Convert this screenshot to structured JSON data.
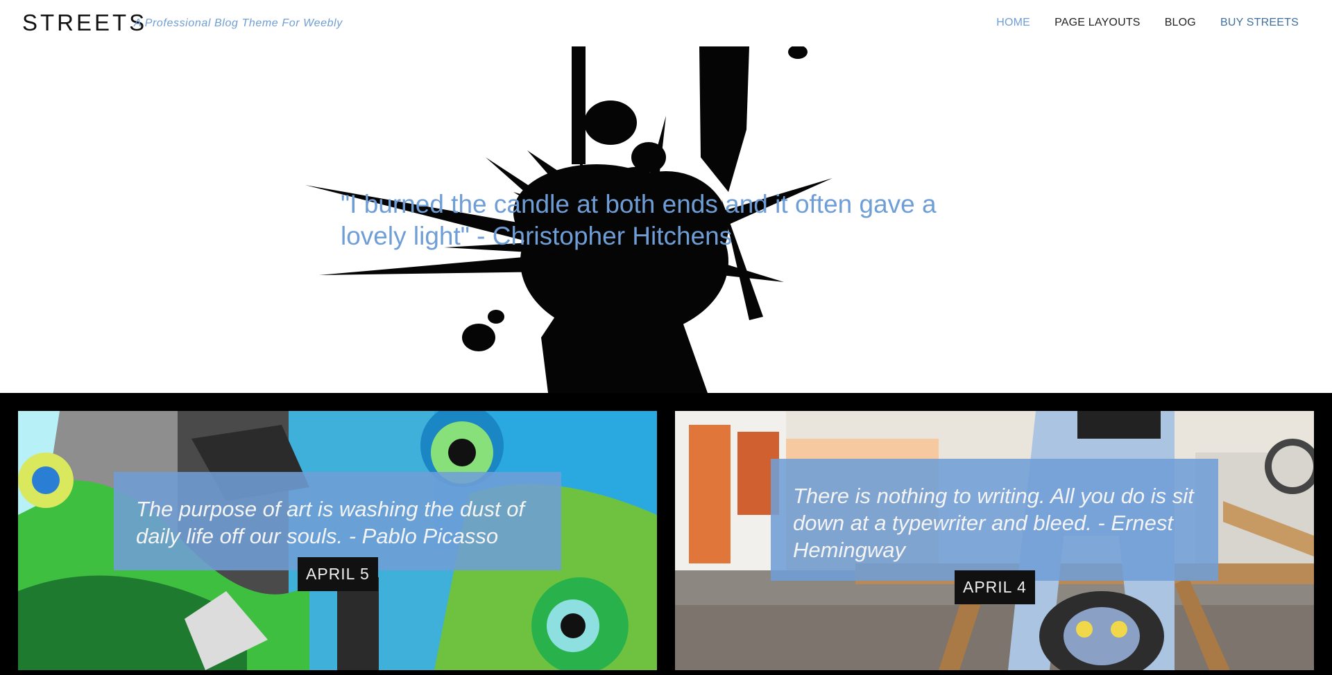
{
  "header": {
    "logo": "STREETS",
    "tagline": "A Professional Blog Theme For Weebly",
    "nav": [
      {
        "label": "HOME"
      },
      {
        "label": "PAGE LAYOUTS"
      },
      {
        "label": "BLOG"
      },
      {
        "label": "BUY STREETS"
      }
    ]
  },
  "hero": {
    "quote": "\"I burned the candle at both ends and it often gave a lovely light\" - Christopher Hitchens"
  },
  "posts": [
    {
      "quote": "The purpose of art is washing the dust of daily life off our souls. - Pablo Picasso",
      "date": "APRIL 5"
    },
    {
      "quote": "There is nothing to writing. All you do is sit down at a typewriter and bleed. - Ernest Hemingway",
      "date": "APRIL 4"
    }
  ],
  "colors": {
    "accent": "#6f9ed6",
    "dark": "#111111"
  }
}
